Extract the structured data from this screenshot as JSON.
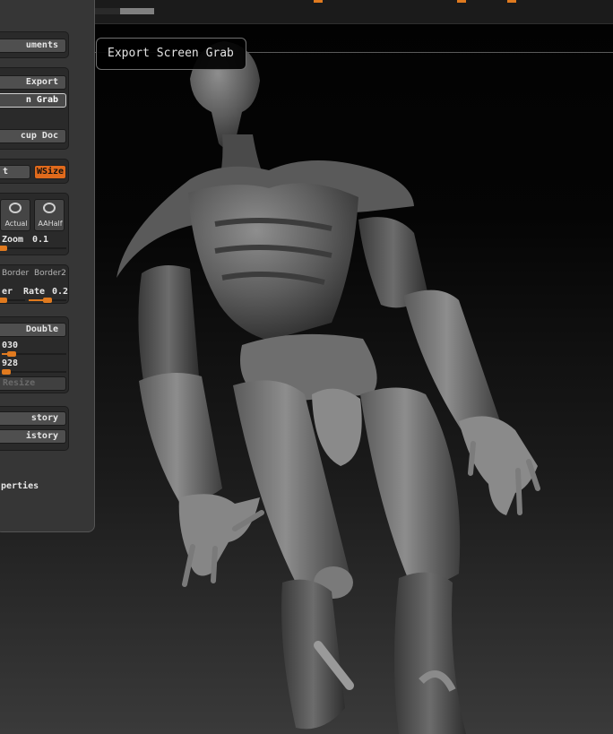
{
  "tooltip": {
    "text": "Export Screen Grab"
  },
  "panel": {
    "buttons": {
      "documents": "uments",
      "export": "Export",
      "screen_grab": "n Grab",
      "setup_doc": "cup Doc",
      "wsize": "WSize",
      "double": "Double",
      "resize": "Resize",
      "history_1": "story",
      "history_2": "istory"
    },
    "left_clip_label": "t",
    "icons": {
      "actual": "Actual",
      "aahalf": "AAHalf"
    },
    "zoom": {
      "label": "Zoom",
      "value": "0.1"
    },
    "border": {
      "label1": "Border",
      "label2": "Border2"
    },
    "rate": {
      "clip_label": "er",
      "label": "Rate",
      "value": "0.2"
    },
    "width_value": "030",
    "height_value": "928",
    "properties": "perties"
  },
  "colors": {
    "accent": "#e07a1f",
    "panel_bg": "#363636",
    "viewport_bg": "#000000"
  },
  "viewport": {
    "subject": "gray sculpted creature model"
  }
}
